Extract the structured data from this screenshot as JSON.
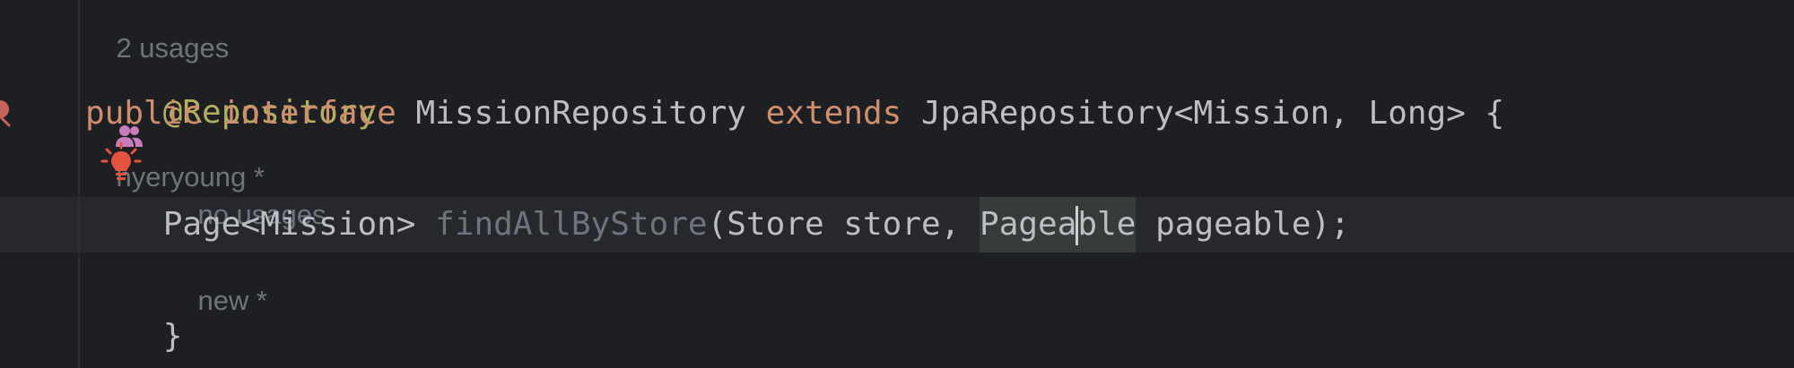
{
  "hints": {
    "top_usages": "2 usages",
    "author": "hyeryoung *",
    "method_usages": "no usages",
    "method_status": "new *"
  },
  "code": {
    "annotation": "@Repository",
    "kw_public": "public",
    "kw_interface": "interface",
    "iface_name": " MissionRepository ",
    "kw_extends": "extends",
    "supertype": " JpaRepository<Mission, Long> {",
    "indent": "    ",
    "return_type": "Page<Mission> ",
    "method_name": "findAllByStore",
    "params_prefix": "(Store store, ",
    "pageable_a": "Pagea",
    "pageable_b": "ble",
    "params_suffix": " pageable);",
    "closing_brace": "}"
  },
  "colors": {
    "background": "#1e1f22",
    "keyword": "#cf8e6d",
    "annotation": "#b3ae60",
    "text": "#bcbec4",
    "hint": "#6f737a",
    "author_icon": "#c77dbb",
    "bulb": "#e5533f"
  },
  "icons": {
    "author": "person-group-icon",
    "intention": "lightbulb-icon",
    "gutter": "implemented-marker-icon"
  }
}
